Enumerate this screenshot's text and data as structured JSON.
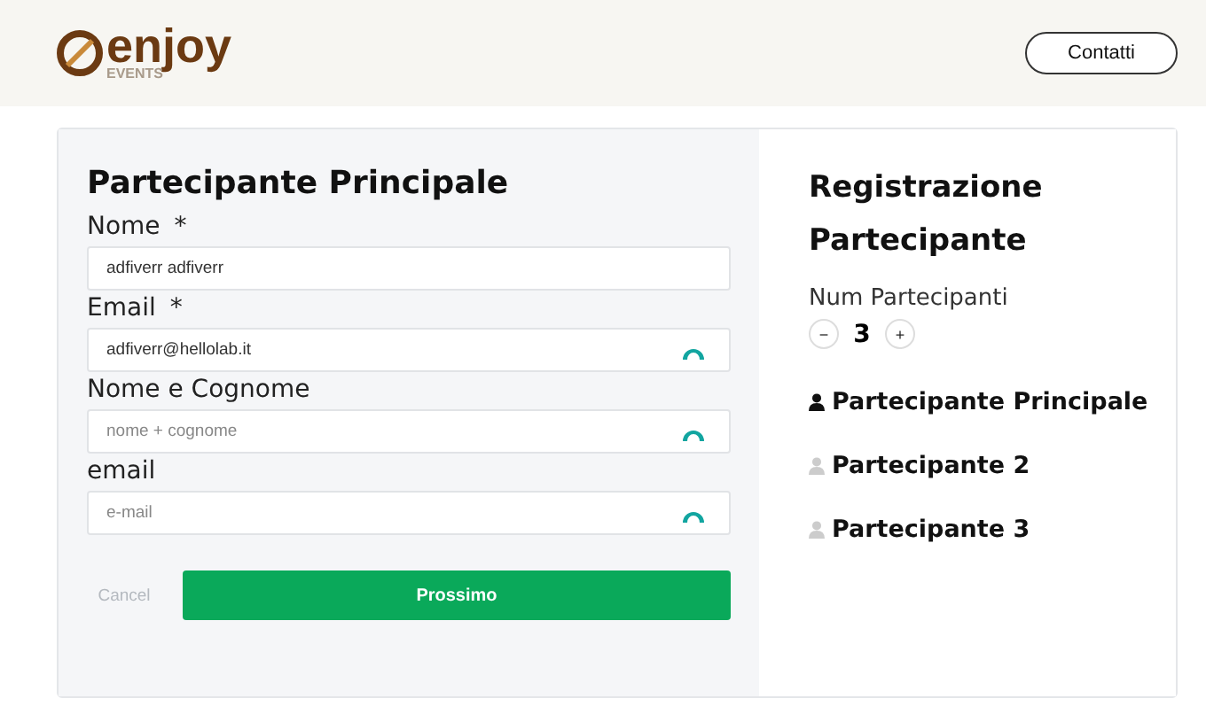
{
  "header": {
    "logo": {
      "word": "enjoy",
      "sub": "EVENTS"
    },
    "contact_button": "Contatti"
  },
  "form": {
    "title": "Partecipante Principale",
    "fields": [
      {
        "label": "Nome",
        "required_mark": "*",
        "value": "adfiverr adfiverr",
        "kind": "plain"
      },
      {
        "label": "Email",
        "required_mark": "*",
        "value": "adfiverr@hellolab.it",
        "kind": "with-icon"
      },
      {
        "label": "Nome e Cognome",
        "placeholder": "nome + cognome",
        "kind": "with-icon"
      },
      {
        "label": "email",
        "placeholder": "e-mail",
        "kind": "with-icon"
      }
    ],
    "cancel": "Cancel",
    "next": "Prossimo"
  },
  "summary": {
    "title": "Registrazione Partecipante",
    "count_label": "Num Partecipanti",
    "minus": "−",
    "count": "3",
    "plus": "+",
    "participants": [
      {
        "name": "Partecipante Principale",
        "selected": true
      },
      {
        "name": "Partecipante 2",
        "selected": false
      },
      {
        "name": "Partecipante 3",
        "selected": false
      }
    ]
  }
}
